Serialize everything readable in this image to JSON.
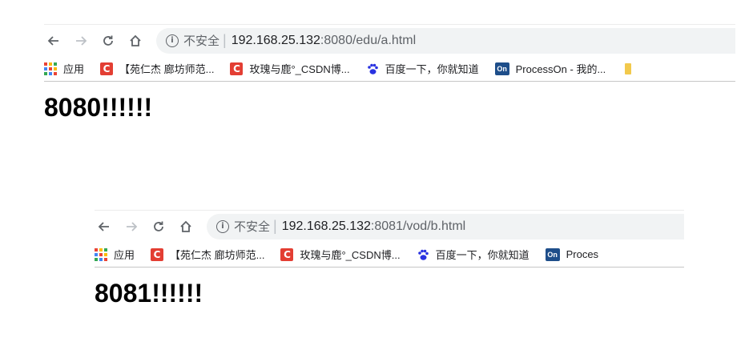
{
  "window_a": {
    "address": {
      "security_label": "不安全",
      "host": "192.168.25.132",
      "rest": ":8080/edu/a.html"
    },
    "bookmarks": [
      {
        "icon": "apps-icon",
        "label": "应用"
      },
      {
        "icon": "csdn-icon",
        "label": "【苑仁杰 廊坊师范..."
      },
      {
        "icon": "csdn-icon",
        "label": "玫瑰与鹿°_CSDN博..."
      },
      {
        "icon": "baidu-paw-icon",
        "label": "百度一下，你就知道"
      },
      {
        "icon": "processon-icon",
        "label": "ProcessOn - 我的..."
      },
      {
        "icon": "folder-icon",
        "label": ""
      }
    ],
    "heading": "8080!!!!!!"
  },
  "window_b": {
    "address": {
      "security_label": "不安全",
      "host": "192.168.25.132",
      "rest": ":8081/vod/b.html"
    },
    "bookmarks": [
      {
        "icon": "apps-icon",
        "label": "应用"
      },
      {
        "icon": "csdn-icon",
        "label": "【苑仁杰 廊坊师范..."
      },
      {
        "icon": "csdn-icon",
        "label": "玫瑰与鹿°_CSDN博..."
      },
      {
        "icon": "baidu-paw-icon",
        "label": "百度一下，你就知道"
      },
      {
        "icon": "processon-icon",
        "label": "Proces"
      }
    ],
    "heading": "8081!!!!!!"
  },
  "icons": {
    "csdn_glyph": "C",
    "processon_glyph": "On",
    "info_glyph": "i"
  },
  "colors": {
    "csdn_red": "#e33e33",
    "processon_blue": "#1e4e8a",
    "omnibox_bg": "#f1f3f4"
  }
}
